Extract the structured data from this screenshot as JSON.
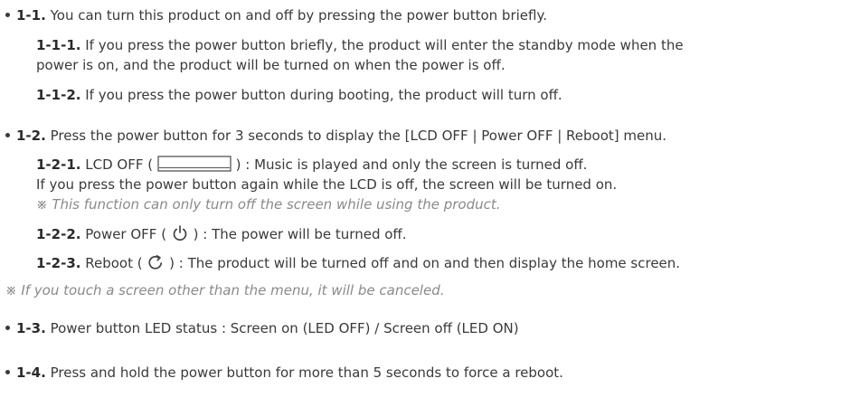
{
  "items": [
    {
      "num": "1-1.",
      "text": "You can turn this product on and off by pressing the power button briefly.",
      "subs": [
        {
          "num": "1-1-1.",
          "text": "If you press the power button briefly, the product will enter the standby mode when the",
          "cont": "power is on, and the product will be turned on when the power is off."
        },
        {
          "num": "1-1-2.",
          "text": "If you press the power button during booting, the product will turn off."
        }
      ]
    },
    {
      "num": "1-2.",
      "text": "Press the power button for 3 seconds to display the [LCD OFF | Power OFF | Reboot] menu.",
      "subs": [
        {
          "num": "1-2-1.",
          "pre": "LCD OFF (",
          "post": ") : Music is played and only the screen is turned off.",
          "cont": "If you press the power button again while the LCD is off, the screen will be turned on.",
          "note": "※ This function can only turn off the screen while using the product.",
          "icon": "lcd-off-icon"
        },
        {
          "num": "1-2-2.",
          "pre": "Power OFF (",
          "post": ") : The power will be turned off.",
          "icon": "power-icon"
        },
        {
          "num": "1-2-3.",
          "pre": "Reboot (",
          "post": ") : The product will be turned off and on and then display the home screen.",
          "icon": "reboot-icon"
        }
      ],
      "note": "※ If you touch a screen other than the menu, it will be canceled."
    },
    {
      "num": "1-3.",
      "text": "Power button LED status : Screen on (LED OFF) / Screen off (LED ON)"
    },
    {
      "num": "1-4.",
      "text": "Press and hold the power button for more than 5 seconds to force a reboot."
    }
  ]
}
